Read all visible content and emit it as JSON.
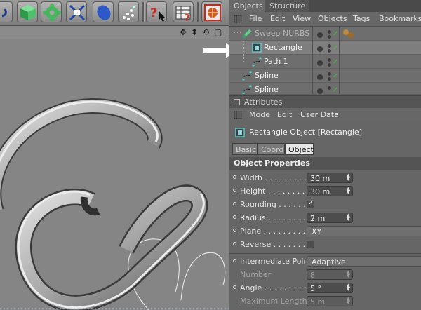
{
  "toolbar": {
    "tools": [
      "undo-icon",
      "cube-icon",
      "gear-icon",
      "scale-arrows-icon",
      "deformer-icon",
      "particles-icon",
      "help-cursor-icon",
      "render-table-icon",
      "render-globe-icon"
    ]
  },
  "viewport": {
    "controls": [
      "✥",
      "⬍",
      "⟲",
      "▢"
    ]
  },
  "objects_panel": {
    "tabs": [
      {
        "label": "Objects"
      },
      {
        "label": "Structure"
      }
    ],
    "menu": [
      "File",
      "Edit",
      "View",
      "Objects",
      "Tags",
      "Bookmarks"
    ],
    "tree": [
      {
        "name": "Sweep NURBS",
        "icon": "sweep-nurbs-icon",
        "dimmed": true
      },
      {
        "name": "Rectangle",
        "icon": "rectangle-spline-icon",
        "selected": true
      },
      {
        "name": "Path 1",
        "icon": "spline-path-icon"
      },
      {
        "name": "Spline",
        "icon": "spline-path-icon"
      },
      {
        "name": "Spline",
        "icon": "spline-path-icon"
      }
    ]
  },
  "attributes_panel": {
    "title": "Attributes",
    "menu": [
      "Mode",
      "Edit",
      "User Data"
    ],
    "object_title": "Rectangle Object [Rectangle]",
    "tabs": [
      "Basic",
      "Coord",
      "Object"
    ],
    "active_tab": "Object",
    "section": "Object Properties",
    "props": {
      "width": {
        "label": "Width . . . . . . . . .",
        "value": "30 m"
      },
      "height": {
        "label": "Height . . . . . . . . .",
        "value": "30 m"
      },
      "rounding": {
        "label": "Rounding . . . . . . .",
        "checked": true
      },
      "radius": {
        "label": "Radius . . . . . . . . .",
        "value": "2 m"
      },
      "plane": {
        "label": "Plane . . . . . . . . . .",
        "value": "XY"
      },
      "reverse": {
        "label": "Reverse . . . . . . . .",
        "checked": false
      },
      "intermediate": {
        "label": "Intermediate Points",
        "value": "Adaptive"
      },
      "number": {
        "label": "Number",
        "value": "8"
      },
      "angle": {
        "label": "Angle . . . . . . . . . .",
        "value": "5 °"
      },
      "max_length": {
        "label": "Maximum Length",
        "value": "5 m"
      }
    }
  },
  "colors": {
    "check_green": "#43c843",
    "selected_row": "#7e7e7e",
    "accent_cyan": "#58d0d8"
  }
}
